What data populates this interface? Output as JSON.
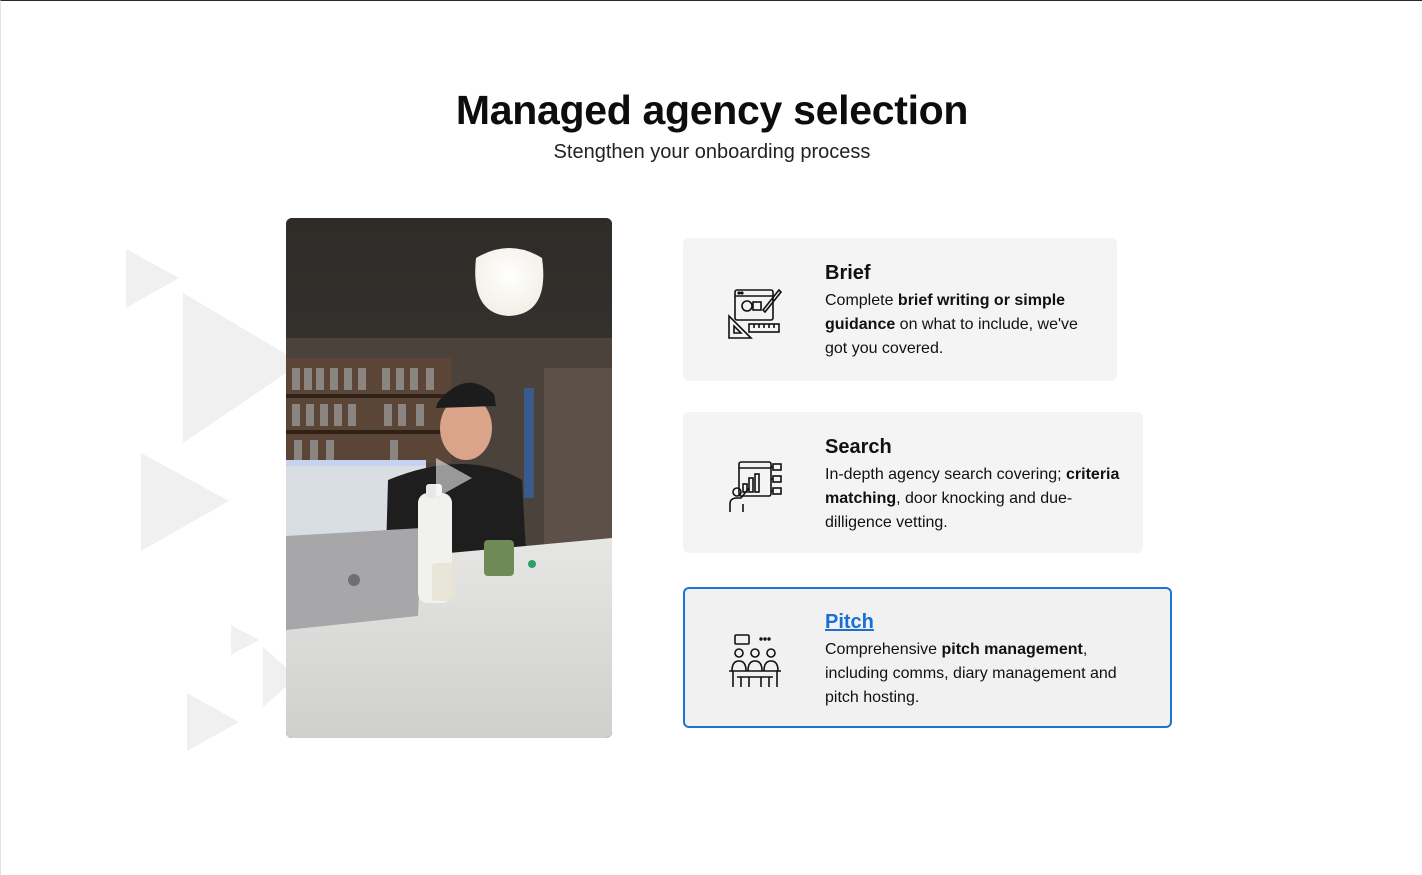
{
  "header": {
    "title": "Managed agency selection",
    "subtitle": "Stengthen your onboarding process"
  },
  "video": {
    "play_icon": "play-icon"
  },
  "cards": [
    {
      "title": "Brief",
      "icon": "brief-design-icon",
      "parts": [
        "Complete ",
        "brief writing or simple guidance",
        " on what to include, we've got you covered."
      ]
    },
    {
      "title": "Search",
      "icon": "search-chart-icon",
      "parts": [
        "In-depth agency search covering; ",
        "criteria matching",
        ", door knocking and due-dilligence vetting."
      ]
    },
    {
      "title": "Pitch",
      "icon": "pitch-meeting-icon",
      "parts": [
        "Comprehensive ",
        "pitch management",
        ", including comms, diary management and pitch hosting."
      ]
    }
  ],
  "colors": {
    "accent": "#1f73d6",
    "card_bg": "#f4f4f4",
    "deco": "#f0f0f0"
  }
}
